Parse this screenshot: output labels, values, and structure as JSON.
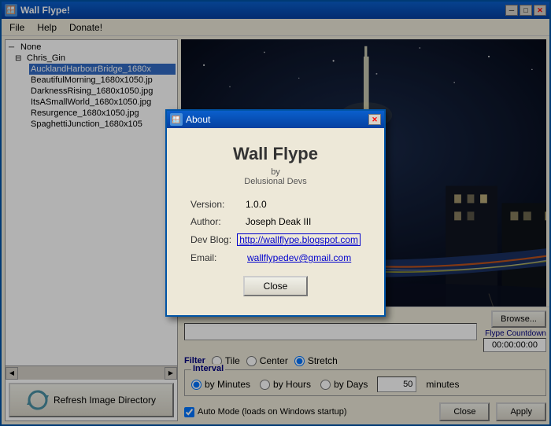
{
  "window": {
    "title": "Wall Flype!",
    "controls": {
      "minimize": "─",
      "maximize": "□",
      "close": "✕"
    }
  },
  "menu": {
    "items": [
      "File",
      "Help",
      "Donate!"
    ]
  },
  "tree": {
    "root": "None",
    "folders": [
      {
        "name": "Chris_Gin",
        "expanded": true,
        "files": [
          "AucklandHarbourBridge_1680x",
          "BeautifulMorning_1680x1050.jp",
          "DarknessRising_1680x1050.jpg",
          "ItsASmallWorld_1680x1050.jpg",
          "Resurgence_1680x1050.jpg",
          "SpaghettiJunction_1680x105"
        ]
      }
    ]
  },
  "controls": {
    "path_placeholder": "",
    "browse_label": "Browse...",
    "filter_label": "Filter",
    "filter_options": [
      "Tile",
      "Center",
      "Stretch"
    ],
    "filter_selected": "Stretch",
    "interval_label": "Interval",
    "interval_options": [
      "by Minutes",
      "by Hours",
      "by Days"
    ],
    "interval_selected": "by Minutes",
    "minutes_value": "50",
    "minutes_label": "minutes",
    "flype_countdown_label": "Flype Countdown",
    "flype_countdown_value": "00:00:00:00",
    "automode_label": "Auto Mode (loads on Windows startup)",
    "close_label": "Close",
    "apply_label": "Apply"
  },
  "refresh_button": {
    "label": "Refresh Image Directory"
  },
  "about_dialog": {
    "title": "About",
    "app_name": "Wall Flype",
    "by_label": "by",
    "developer": "Delusional Devs",
    "version_label": "Version:",
    "version_value": "1.0.0",
    "author_label": "Author:",
    "author_value": "Joseph Deak III",
    "devblog_label": "Dev Blog:",
    "devblog_url": "http://wallflype.blogspot.com",
    "email_label": "Email:",
    "email_value": "wallflypedev@gmail.com",
    "close_label": "Close"
  }
}
